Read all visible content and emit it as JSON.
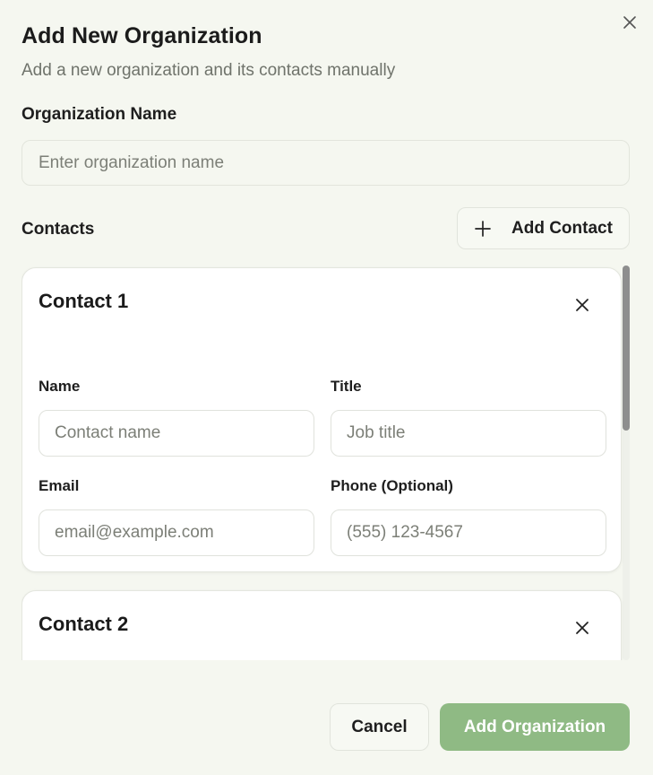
{
  "dialog": {
    "title": "Add New Organization",
    "subtitle": "Add a new organization and its contacts manually",
    "close_icon": "close-icon"
  },
  "organization": {
    "label": "Organization Name",
    "value": "",
    "placeholder": "Enter organization name"
  },
  "contacts": {
    "label": "Contacts",
    "add_button_label": "Add Contact",
    "add_icon": "plus-icon",
    "items": [
      {
        "title": "Contact 1",
        "name_label": "Name",
        "name_placeholder": "Contact name",
        "title_label": "Title",
        "title_placeholder": "Job title",
        "email_label": "Email",
        "email_placeholder": "email@example.com",
        "phone_label": "Phone (Optional)",
        "phone_placeholder": "(555) 123-4567"
      },
      {
        "title": "Contact 2"
      }
    ]
  },
  "footer": {
    "cancel_label": "Cancel",
    "submit_label": "Add Organization"
  },
  "colors": {
    "background": "#f5f7f0",
    "accent": "#8fba84",
    "muted_text": "#6f736b"
  }
}
